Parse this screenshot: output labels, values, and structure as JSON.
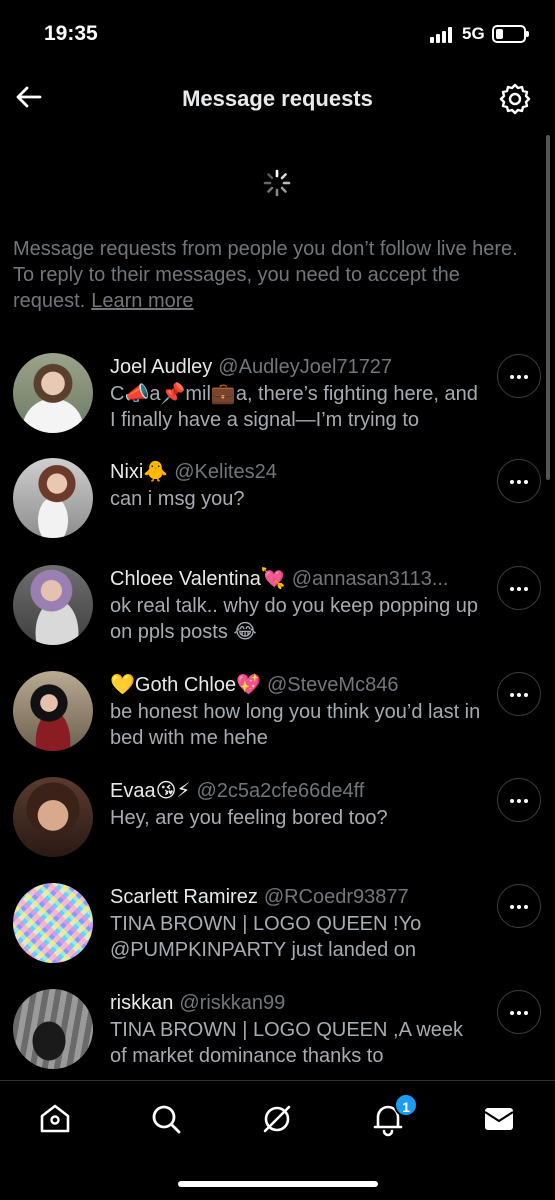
{
  "status_bar": {
    "time": "19:35",
    "network": "5G"
  },
  "header": {
    "title": "Message requests"
  },
  "info": {
    "text": "Message requests from people you don’t follow live here. To reply to their messages, you need to accept the request.",
    "learn_more": "Learn more"
  },
  "requests": [
    {
      "name": "Joel Audley",
      "handle": "@AudleyJoel71727",
      "preview": "C📣a📌mil💼a, there’s fighting here, and I finally have a signal—I’m trying to"
    },
    {
      "name": "Nixi🐥",
      "handle": "@Kelites24",
      "preview": "can i msg you?"
    },
    {
      "name": "Chloee Valentina💘",
      "handle": "@annasan3113...",
      "preview": "ok real talk.. why do you keep popping up on ppls posts 😂"
    },
    {
      "name": "💛Goth Chloe💖",
      "handle": "@SteveMc846",
      "preview": "be honest how long you think you’d last in bed with me hehe"
    },
    {
      "name": "Evaa😘⚡",
      "handle": "@2c5a2cfe66de4ff",
      "preview": "Hey, are you feeling bored too?"
    },
    {
      "name": "Scarlett Ramirez",
      "handle": "@RCoedr93877",
      "preview": "TINA BROWN | LOGO QUEEN !Yo @PUMPKINPARTY just landed on"
    },
    {
      "name": "riskkan",
      "handle": "@riskkan99",
      "preview": "TINA BROWN | LOGO QUEEN ,A week of market dominance thanks to"
    }
  ],
  "bottom_nav": {
    "items": [
      "home-icon",
      "search-icon",
      "grok-icon",
      "notifications-icon",
      "messages-icon"
    ],
    "notification_count": "1"
  },
  "colors": {
    "background": "#000000",
    "text": "#e7e9ea",
    "muted": "#71767b",
    "accent": "#1d9bf0"
  }
}
